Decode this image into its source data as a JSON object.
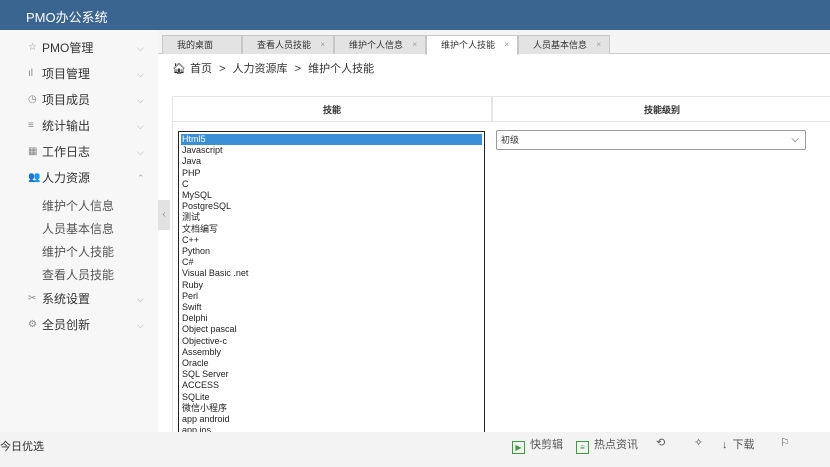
{
  "app": {
    "title": "PMO办公系统"
  },
  "sidebar": {
    "items": [
      {
        "label": "PMO管理",
        "icon": "star-icon"
      },
      {
        "label": "项目管理",
        "icon": "bar-chart-icon"
      },
      {
        "label": "项目成员",
        "icon": "clock-icon"
      },
      {
        "label": "统计输出",
        "icon": "list-icon"
      },
      {
        "label": "工作日志",
        "icon": "calendar-icon"
      },
      {
        "label": "人力资源",
        "icon": "users-icon"
      }
    ],
    "submenu": [
      "维护个人信息",
      "人员基本信息",
      "维护个人技能",
      "查看人员技能"
    ],
    "items_after": [
      {
        "label": "系统设置",
        "icon": "wrench-icon"
      },
      {
        "label": "全员创新",
        "icon": "cog-icon"
      }
    ]
  },
  "tabs": [
    "我的桌面",
    "查看人员技能",
    "维护个人信息",
    "维护个人技能",
    "人员基本信息"
  ],
  "active_tab_index": 3,
  "breadcrumb": {
    "home": "首页",
    "sep": ">",
    "level1": "人力资源库",
    "level2": "维护个人技能"
  },
  "form": {
    "col_skill": "技能",
    "col_level": "技能级别",
    "skills": [
      "Html5",
      "Javascript",
      "Java",
      "PHP",
      "C",
      "MySQL",
      "PostgreSQL",
      "测试",
      "文档编写",
      "C++",
      "Python",
      "C#",
      "Visual Basic .net",
      "Ruby",
      "Perl",
      "Swift",
      "Delphi",
      "Object pascal",
      "Objective-c",
      "Assembly",
      "Oracle",
      "SQL Server",
      "ACCESS",
      "SQLite",
      "微信小程序",
      "app android",
      "app ios"
    ],
    "selected_skill_index": 0,
    "level_value": "初级"
  },
  "statusbar": {
    "left": "今日优选",
    "items": [
      "快剪辑",
      "热点资讯",
      "",
      "",
      "下载",
      ""
    ]
  },
  "colors": {
    "header": "#3a6591",
    "selection": "#3b8fd6",
    "accent_green": "#3c9d3c"
  }
}
